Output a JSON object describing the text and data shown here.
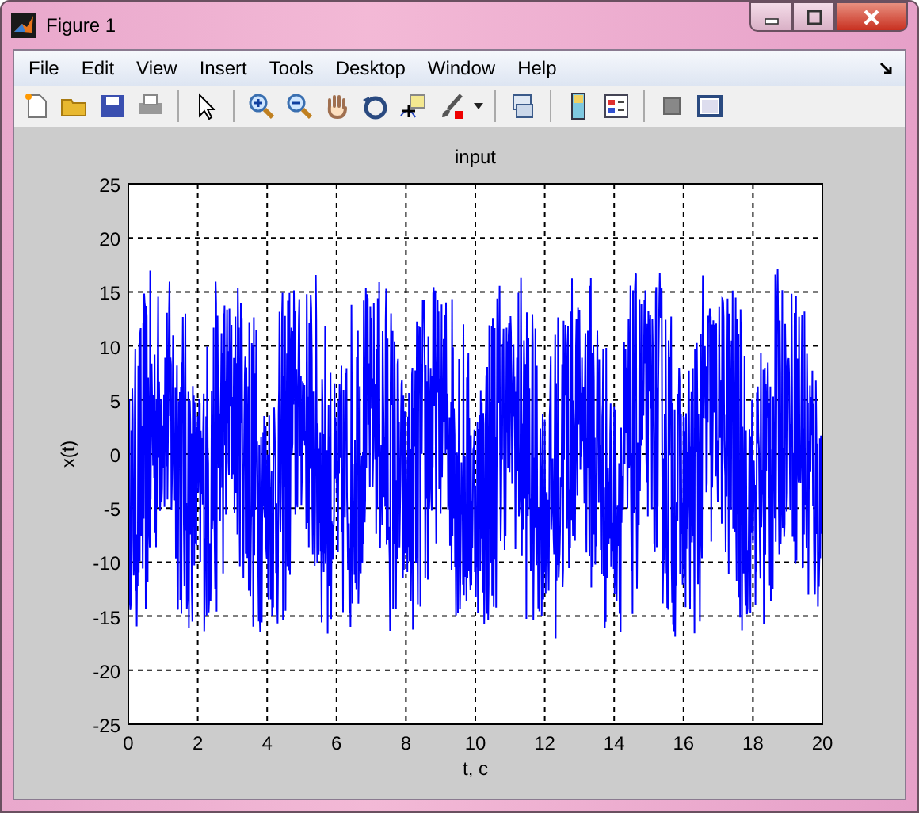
{
  "window": {
    "title": "Figure 1"
  },
  "menu": [
    "File",
    "Edit",
    "View",
    "Insert",
    "Tools",
    "Desktop",
    "Window",
    "Help"
  ],
  "plot": {
    "title": "input",
    "xlabel": "t, c",
    "ylabel": "x(t)",
    "xticks": [
      "0",
      "2",
      "4",
      "6",
      "8",
      "10",
      "12",
      "14",
      "16",
      "18",
      "20"
    ],
    "yticks": [
      "25",
      "20",
      "15",
      "10",
      "5",
      "0",
      "-5",
      "-10",
      "-15",
      "-20",
      "-25"
    ]
  }
}
